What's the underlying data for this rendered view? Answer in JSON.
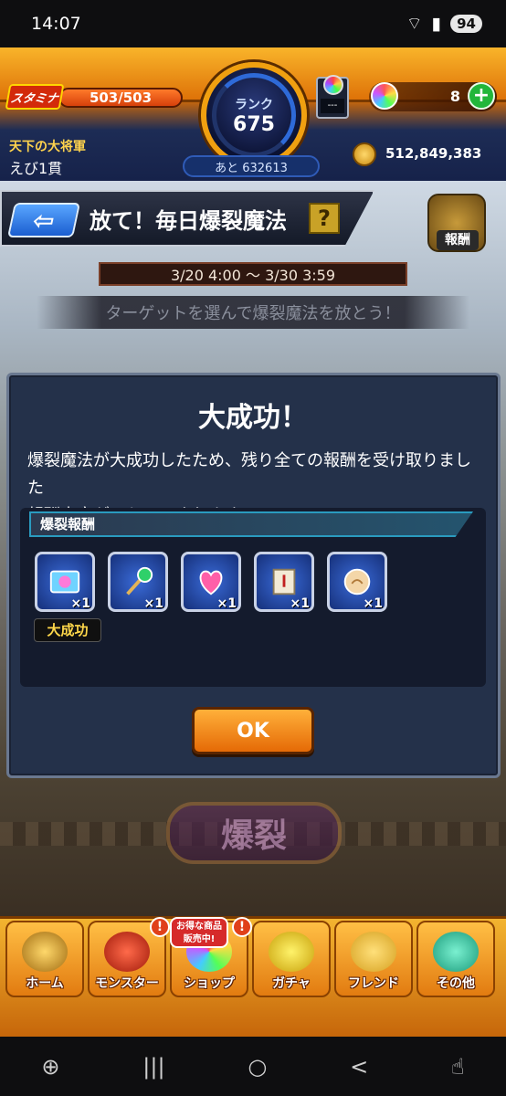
{
  "statusbar": {
    "time": "14:07",
    "battery": "94"
  },
  "header": {
    "stamina_label": "スタミナ",
    "stamina_value": "503/503",
    "rank_label": "ランク",
    "rank_value": "675",
    "next_rank": "あと 632613",
    "item_count": "---",
    "orb_count": "8",
    "plus": "+",
    "player_title": "天下の大将軍",
    "player_name": "えび1貫",
    "coins": "512,849,383"
  },
  "event": {
    "back": "⇦",
    "title": "放て！毎日爆裂魔法",
    "help": "?",
    "reward_label": "報酬",
    "dates": "3/20 4:00 ～ 3/30 3:59",
    "hint": "ターゲットを選んで爆裂魔法を放とう！"
  },
  "modal": {
    "title": "大成功！",
    "message_line1": "爆裂魔法が大成功したため、残り全ての報酬を受け取りました",
    "message_line2": "報酬内容がリセットされます",
    "section_title": "爆裂報酬",
    "items": [
      {
        "icon": "ticket-icon",
        "qty": "×1"
      },
      {
        "icon": "wand-icon",
        "qty": "×1"
      },
      {
        "icon": "heart-potion-icon",
        "qty": "×1"
      },
      {
        "icon": "scroll-icon",
        "qty": "×1"
      },
      {
        "icon": "cookie-icon",
        "qty": "×1"
      }
    ],
    "success_tag": "大成功",
    "ok": "OK"
  },
  "burst_button": "爆裂",
  "nav": {
    "sale": "お得な商品 販売中!",
    "items": [
      {
        "label": "ホーム"
      },
      {
        "label": "モンスター",
        "badge": "!"
      },
      {
        "label": "ショップ",
        "badge": "!"
      },
      {
        "label": "ガチャ"
      },
      {
        "label": "フレンド"
      },
      {
        "label": "その他"
      }
    ]
  },
  "android_nav": {
    "recents": "|||",
    "home": "○",
    "back": "<"
  },
  "colors": {
    "accent": "#e56a06",
    "modal_bg": "#24314a",
    "section_border": "#2a9bbf"
  }
}
